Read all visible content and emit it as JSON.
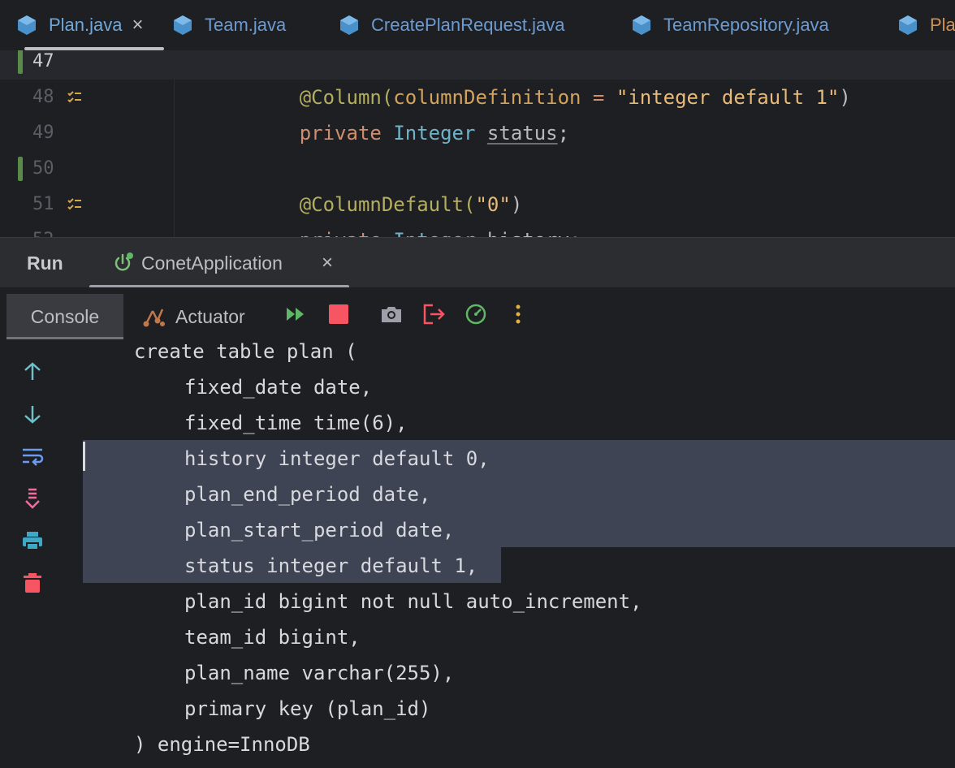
{
  "editor_tabs": [
    {
      "label": "Plan.java",
      "active": true,
      "closable": true
    },
    {
      "label": "Team.java",
      "active": false
    },
    {
      "label": "CreatePlanRequest.java",
      "active": false
    },
    {
      "label": "TeamRepository.java",
      "active": false
    },
    {
      "label": "Pla",
      "active": false
    }
  ],
  "editor": {
    "lines": [
      {
        "num": "47",
        "parts": [
          "@Column(",
          "columnDefinition",
          " = ",
          "\"integer default 1\"",
          ")"
        ]
      },
      {
        "num": "48",
        "parts": [
          "private",
          "Integer",
          "status",
          ";"
        ]
      },
      {
        "num": "49",
        "parts": []
      },
      {
        "num": "50",
        "parts": [
          "@ColumnDefault(",
          "\"0\"",
          ")"
        ]
      },
      {
        "num": "51",
        "parts": [
          "private",
          "Integer",
          "history",
          ";"
        ]
      },
      {
        "num": "52",
        "parts": []
      }
    ]
  },
  "run_panel": {
    "title": "Run",
    "config_tab": "ConetApplication",
    "close_glyph": "×"
  },
  "console_toolbar": {
    "console_tab": "Console",
    "actuator_tab": "Actuator",
    "icons": [
      "resume-icon",
      "stop-icon",
      "camera-icon",
      "exit-icon",
      "gauge-icon",
      "more-icon"
    ]
  },
  "console": {
    "lines": [
      {
        "text": "create table plan (",
        "indent": false
      },
      {
        "text": "fixed_date date,",
        "indent": true
      },
      {
        "text": "fixed_time time(6),",
        "indent": true
      },
      {
        "text": "history integer default 0,",
        "indent": true
      },
      {
        "text": "plan_end_period date,",
        "indent": true
      },
      {
        "text": "plan_start_period date,",
        "indent": true
      },
      {
        "text": "status integer default 1,",
        "indent": true
      },
      {
        "text": "plan_id bigint not null auto_increment,",
        "indent": true
      },
      {
        "text": "team_id bigint,",
        "indent": true
      },
      {
        "text": "plan_name varchar(255),",
        "indent": true
      },
      {
        "text": "primary key (plan_id)",
        "indent": true
      },
      {
        "text": ") engine=InnoDB",
        "indent": false
      }
    ],
    "side_tools": [
      "scroll-up-icon",
      "scroll-down-icon",
      "soft-wrap-icon",
      "scroll-to-end-icon",
      "print-icon",
      "clear-icon"
    ]
  },
  "colors": {
    "background": "#1e1f22",
    "selection": "#3f4454",
    "accent_blue": "#6fa8dc",
    "stop_red": "#f75464",
    "run_green": "#5fb865"
  }
}
